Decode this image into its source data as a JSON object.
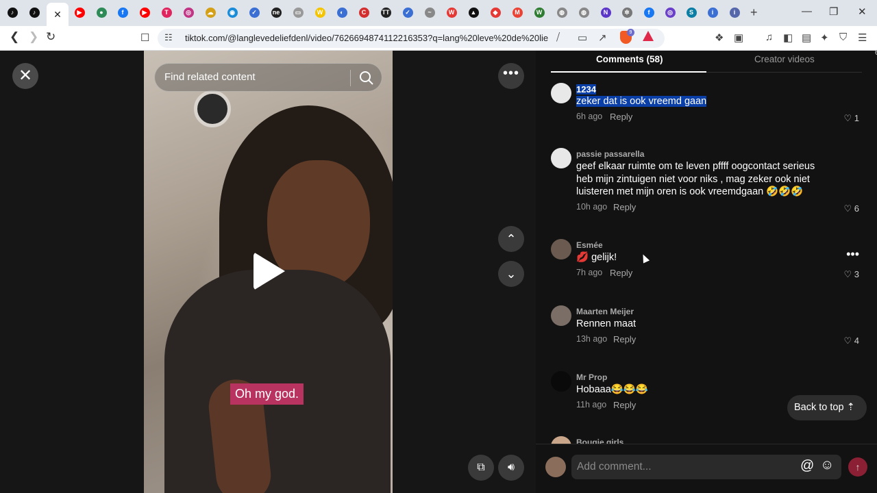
{
  "browser": {
    "tabs": [
      {
        "icon": "tiktok-favicon",
        "color": "#111111",
        "glyph": "♪"
      },
      {
        "icon": "tiktok-favicon",
        "color": "#111111",
        "glyph": "♪"
      },
      {
        "icon": "close-icon",
        "active": true
      },
      {
        "icon": "youtube-favicon",
        "color": "#ff0000",
        "glyph": "▶"
      },
      {
        "icon": "green-circle-favicon",
        "color": "#2e8b57",
        "glyph": "●"
      },
      {
        "icon": "facebook-favicon",
        "color": "#1877f2",
        "glyph": "f"
      },
      {
        "icon": "youtube-favicon",
        "color": "#ff0000",
        "glyph": "▶"
      },
      {
        "icon": "pink-square-favicon",
        "color": "#e0245e",
        "glyph": "T"
      },
      {
        "icon": "instagram-favicon",
        "color": "#c13584",
        "glyph": "◎"
      },
      {
        "icon": "generic-favicon",
        "color": "#d4a017",
        "glyph": "☁"
      },
      {
        "icon": "blue-circle-favicon",
        "color": "#1a8cd8",
        "glyph": "◉"
      },
      {
        "icon": "blue-favicon",
        "color": "#3b6fd4",
        "glyph": "✓"
      },
      {
        "icon": "ne-favicon",
        "color": "#222222",
        "glyph": "ne"
      },
      {
        "icon": "gray-favicon",
        "color": "#999999",
        "glyph": "▭"
      },
      {
        "icon": "w-favicon",
        "color": "#f5c400",
        "glyph": "W"
      },
      {
        "icon": "blue-favicon",
        "color": "#3b6fd4",
        "glyph": "◐"
      },
      {
        "icon": "red-favicon",
        "color": "#d32f2f",
        "glyph": "C"
      },
      {
        "icon": "tt-favicon",
        "color": "#222222",
        "glyph": "TT"
      },
      {
        "icon": "blue-favicon",
        "color": "#3b6fd4",
        "glyph": "✓"
      },
      {
        "icon": "gray-favicon",
        "color": "#888888",
        "glyph": "~"
      },
      {
        "icon": "w-red-favicon",
        "color": "#e53935",
        "glyph": "W"
      },
      {
        "icon": "black-favicon",
        "color": "#111111",
        "glyph": "▲"
      },
      {
        "icon": "red-favicon",
        "color": "#e53935",
        "glyph": "◆"
      },
      {
        "icon": "gmail-favicon",
        "color": "#ea4335",
        "glyph": "M"
      },
      {
        "icon": "green-favicon",
        "color": "#2e7d32",
        "glyph": "W"
      },
      {
        "icon": "globe-favicon",
        "color": "#888888",
        "glyph": "◍"
      },
      {
        "icon": "globe-favicon",
        "color": "#888888",
        "glyph": "◍"
      },
      {
        "icon": "purple-favicon",
        "color": "#5c35c9",
        "glyph": "N"
      },
      {
        "icon": "settings-favicon",
        "color": "#777777",
        "glyph": "✲"
      },
      {
        "icon": "facebook-favicon",
        "color": "#1877f2",
        "glyph": "f"
      },
      {
        "icon": "purple-favicon",
        "color": "#6a3fc9",
        "glyph": "◎"
      },
      {
        "icon": "teal-favicon",
        "color": "#0a7ea4",
        "glyph": "S"
      },
      {
        "icon": "info-favicon",
        "color": "#3c6fd4",
        "glyph": "i"
      },
      {
        "icon": "info-favicon",
        "color": "#5566aa",
        "glyph": "i"
      }
    ],
    "url": "tiktok.com/@langlevedeliefdenl/video/7626694874112216353?q=lang%20leve%20de%20lie...",
    "shields_count": "9"
  },
  "video": {
    "search_placeholder": "Find related content",
    "caption": "Oh my god."
  },
  "comments_panel": {
    "tab_comments": "Comments (58)",
    "tab_creator": "Creator videos",
    "top_count": "6",
    "comments": [
      {
        "user": "1234",
        "text": "zeker dat is ook vreemd gaan",
        "time": "6h ago",
        "reply": "Reply",
        "likes": "1",
        "avatar_color": "#e8e8e8",
        "selected": true
      },
      {
        "user": "passie passarella",
        "text": "geef elkaar ruimte om te leven pffff oogcontact serieus heb mijn zintuigen niet voor niks , mag zeker ook niet luisteren met mijn oren is ook vreemdgaan 🤣🤣🤣",
        "time": "10h ago",
        "reply": "Reply",
        "likes": "6",
        "avatar_color": "#e8e8e8"
      },
      {
        "user": "Esmée",
        "text": "💋 gelijk!",
        "time": "7h ago",
        "reply": "Reply",
        "likes": "3",
        "avatar_color": "#6b5a50"
      },
      {
        "user": "Maarten Meijer",
        "text": "Rennen maat",
        "time": "13h ago",
        "reply": "Reply",
        "likes": "4",
        "avatar_color": "#7a6e66"
      },
      {
        "user": "Mr Prop",
        "text": "Hobaaa😂😂😂",
        "time": "11h ago",
        "reply": "Reply",
        "likes": "",
        "avatar_color": "#0a0a0a"
      },
      {
        "user": "Bougie girls",
        "text": "",
        "time": "",
        "reply": "",
        "likes": "",
        "avatar_color": "#c9a58a"
      }
    ],
    "back_to_top": "Back to top ⇡",
    "add_comment_placeholder": "Add comment...",
    "at_symbol": "@",
    "emoji_symbol": "☺"
  }
}
